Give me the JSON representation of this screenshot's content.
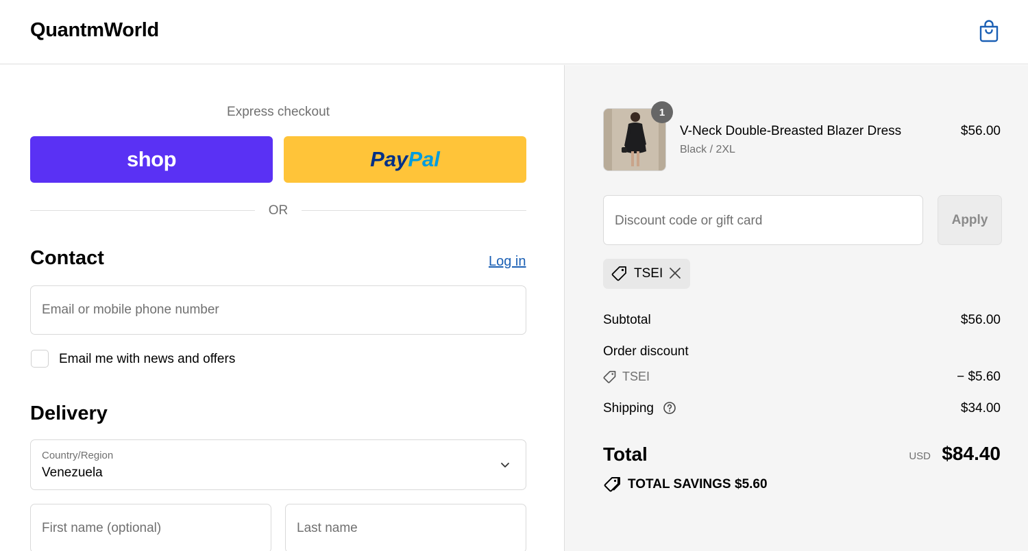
{
  "header": {
    "brand": "QuantmWorld",
    "cart_icon": "shopping-bag-icon"
  },
  "express": {
    "label": "Express checkout",
    "shop_label": "shop",
    "paypal_part1": "Pay",
    "paypal_part2": "Pal",
    "or_label": "OR"
  },
  "contact": {
    "title": "Contact",
    "login_label": "Log in",
    "email_placeholder": "Email or mobile phone number",
    "newsletter_label": "Email me with news and offers",
    "newsletter_checked": false
  },
  "delivery": {
    "title": "Delivery",
    "country_label": "Country/Region",
    "country_value": "Venezuela",
    "first_name_placeholder": "First name (optional)",
    "last_name_placeholder": "Last name"
  },
  "order": {
    "item": {
      "name": "V-Neck Double-Breasted Blazer Dress",
      "variant": "Black / 2XL",
      "price": "$56.00",
      "quantity": "1"
    },
    "discount_placeholder": "Discount code or gift card",
    "apply_label": "Apply",
    "applied_code": "TSEI",
    "subtotal_label": "Subtotal",
    "subtotal_value": "$56.00",
    "order_discount_label": "Order discount",
    "discount_code": "TSEI",
    "discount_value": "− $5.60",
    "shipping_label": "Shipping",
    "shipping_value": "$34.00",
    "total_label": "Total",
    "currency": "USD",
    "total_value": "$84.40",
    "savings_label": "TOTAL SAVINGS",
    "savings_value": "$5.60"
  },
  "colors": {
    "shop_purple": "#5a31f4",
    "paypal_yellow": "#ffc439",
    "paypal_dark_blue": "#003087",
    "paypal_light_blue": "#009cde",
    "link_blue": "#1a5fb4",
    "summary_bg": "#f5f5f5"
  }
}
